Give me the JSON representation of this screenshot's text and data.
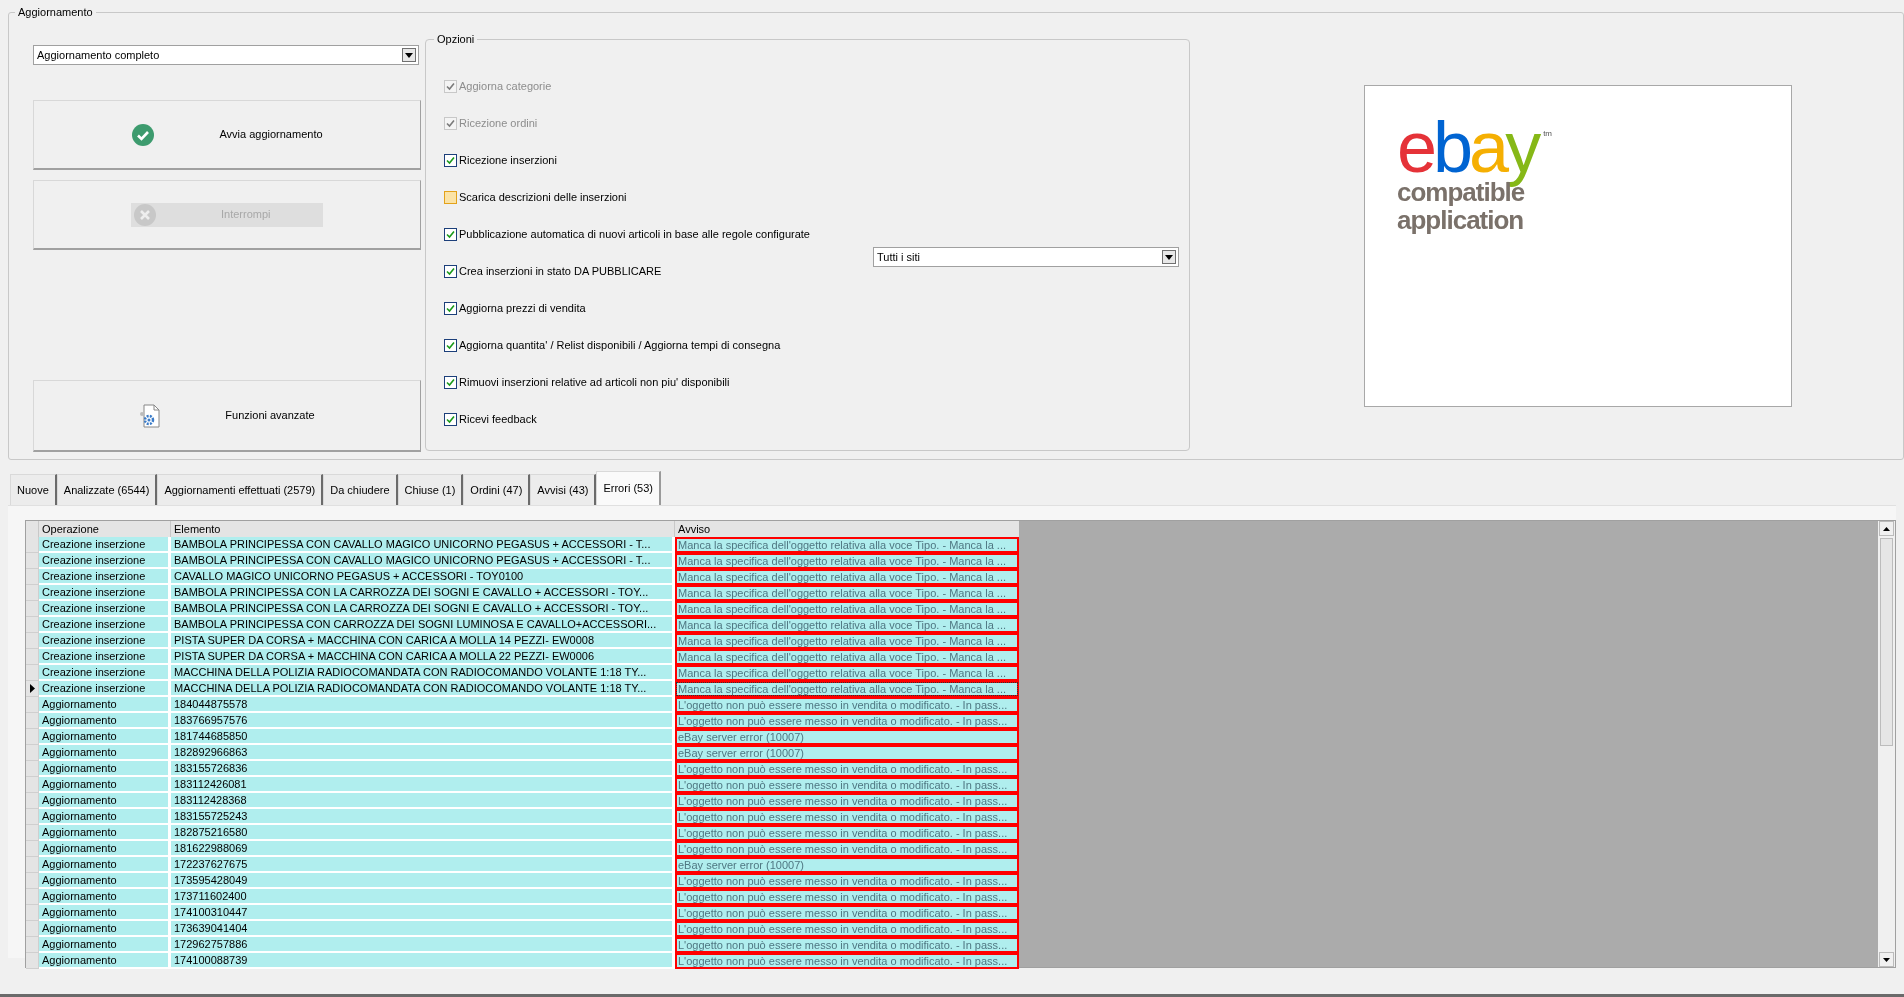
{
  "group_title": "Aggiornamento",
  "mode_dropdown": {
    "value": "Aggiornamento completo"
  },
  "buttons": [
    {
      "kind": "start",
      "label": "Avvia aggiornamento",
      "disabled": false
    },
    {
      "kind": "stop",
      "label": "Interrompi",
      "disabled": true
    },
    {
      "kind": "advanced",
      "label": "Funzioni avanzate",
      "disabled": false
    }
  ],
  "options": {
    "title": "Opzioni",
    "items": [
      {
        "label": "Aggiorna categorie",
        "checked": true,
        "disabled": true
      },
      {
        "label": "Ricezione ordini",
        "checked": true,
        "disabled": true
      },
      {
        "label": "Ricezione inserzioni",
        "checked": true,
        "disabled": false
      },
      {
        "label": "Scarica descrizioni delle inserzioni",
        "checked": false,
        "disabled": false
      },
      {
        "label": "Pubblicazione automatica di nuovi articoli in base alle regole configurate",
        "checked": true,
        "disabled": false
      },
      {
        "label": "Crea inserzioni in stato DA PUBBLICARE",
        "checked": true,
        "disabled": false
      },
      {
        "label": "Aggiorna prezzi di vendita",
        "checked": true,
        "disabled": false
      },
      {
        "label": "Aggiorna quantita' / Relist disponibili / Aggiorna tempi di consegna",
        "checked": true,
        "disabled": false
      },
      {
        "label": "Rimuovi inserzioni relative ad articoli non piu' disponibili",
        "checked": true,
        "disabled": false
      },
      {
        "label": "Ricevi feedback",
        "checked": true,
        "disabled": false
      }
    ],
    "site_dropdown": {
      "value": "Tutti i siti"
    }
  },
  "logo": {
    "letters": [
      {
        "text": "e",
        "color": "#e53238"
      },
      {
        "text": "b",
        "color": "#0064d2"
      },
      {
        "text": "a",
        "color": "#f5af02"
      },
      {
        "text": "y",
        "color": "#86b817"
      }
    ],
    "tm": "tm",
    "lines": [
      "compatible",
      "application"
    ]
  },
  "tabs": [
    {
      "label": "Nuove",
      "selected": false
    },
    {
      "label": "Analizzate (6544)",
      "selected": false
    },
    {
      "label": "Aggiornamenti effettuati (2579)",
      "selected": false
    },
    {
      "label": "Da chiudere",
      "selected": false
    },
    {
      "label": "Chiuse (1)",
      "selected": false
    },
    {
      "label": "Ordini (47)",
      "selected": false
    },
    {
      "label": "Avvisi (43)",
      "selected": false
    },
    {
      "label": "Errori (53)",
      "selected": true
    }
  ],
  "table": {
    "columns": [
      "Operazione",
      "Elemento",
      "Avviso"
    ],
    "rows": [
      {
        "operazione": "Creazione inserzione",
        "elemento": "BAMBOLA PRINCIPESSA CON CAVALLO MAGICO UNICORNO PEGASUS + ACCESSORI - T...",
        "avviso": "Manca la specifica dell'oggetto relativa alla voce Tipo. - Manca la ...",
        "selected": false
      },
      {
        "operazione": "Creazione inserzione",
        "elemento": "BAMBOLA PRINCIPESSA CON CAVALLO MAGICO UNICORNO PEGASUS + ACCESSORI - T...",
        "avviso": "Manca la specifica dell'oggetto relativa alla voce Tipo. - Manca la ...",
        "selected": false
      },
      {
        "operazione": "Creazione inserzione",
        "elemento": "CAVALLO MAGICO UNICORNO PEGASUS + ACCESSORI - TOY0100",
        "avviso": "Manca la specifica dell'oggetto relativa alla voce Tipo. - Manca la ...",
        "selected": false
      },
      {
        "operazione": "Creazione inserzione",
        "elemento": "BAMBOLA PRINCIPESSA CON LA CARROZZA DEI SOGNI E CAVALLO + ACCESSORI - TOY...",
        "avviso": "Manca la specifica dell'oggetto relativa alla voce Tipo. - Manca la ...",
        "selected": false
      },
      {
        "operazione": "Creazione inserzione",
        "elemento": "BAMBOLA PRINCIPESSA CON LA CARROZZA DEI SOGNI E CAVALLO + ACCESSORI - TOY...",
        "avviso": "Manca la specifica dell'oggetto relativa alla voce Tipo. - Manca la ...",
        "selected": false
      },
      {
        "operazione": "Creazione inserzione",
        "elemento": "BAMBOLA PRINCIPESSA CON CARROZZA DEI SOGNI LUMINOSA E CAVALLO+ACCESSORI...",
        "avviso": "Manca la specifica dell'oggetto relativa alla voce Tipo. - Manca la ...",
        "selected": false
      },
      {
        "operazione": "Creazione inserzione",
        "elemento": "PISTA SUPER DA CORSA + MACCHINA CON CARICA A MOLLA 14 PEZZI- EW0008",
        "avviso": "Manca la specifica dell'oggetto relativa alla voce Tipo. - Manca la ...",
        "selected": false
      },
      {
        "operazione": "Creazione inserzione",
        "elemento": "PISTA SUPER DA CORSA + MACCHINA CON CARICA A MOLLA 22 PEZZI- EW0006",
        "avviso": "Manca la specifica dell'oggetto relativa alla voce Tipo. - Manca la ...",
        "selected": false
      },
      {
        "operazione": "Creazione inserzione",
        "elemento": "MACCHINA DELLA POLIZIA RADIOCOMANDATA CON RADIOCOMANDO VOLANTE 1:18 TY...",
        "avviso": "Manca la specifica dell'oggetto relativa alla voce Tipo. - Manca la ...",
        "selected": false
      },
      {
        "operazione": "Creazione inserzione",
        "elemento": "MACCHINA DELLA POLIZIA RADIOCOMANDATA CON RADIOCOMANDO VOLANTE 1:18 TY...",
        "avviso": "Manca la specifica dell'oggetto relativa alla voce Tipo. - Manca la ...",
        "selected": true
      },
      {
        "operazione": "Aggiornamento",
        "elemento": "184044875578",
        "avviso": "L'oggetto non può essere messo in vendita o modificato. - In pass...",
        "selected": false
      },
      {
        "operazione": "Aggiornamento",
        "elemento": "183766957576",
        "avviso": "L'oggetto non può essere messo in vendita o modificato. - In pass...",
        "selected": false
      },
      {
        "operazione": "Aggiornamento",
        "elemento": "181744685850",
        "avviso": "eBay server error (10007)",
        "selected": false
      },
      {
        "operazione": "Aggiornamento",
        "elemento": "182892966863",
        "avviso": "eBay server error (10007)",
        "selected": false
      },
      {
        "operazione": "Aggiornamento",
        "elemento": "183155726836",
        "avviso": "L'oggetto non può essere messo in vendita o modificato. - In pass...",
        "selected": false
      },
      {
        "operazione": "Aggiornamento",
        "elemento": "183112426081",
        "avviso": "L'oggetto non può essere messo in vendita o modificato. - In pass...",
        "selected": false
      },
      {
        "operazione": "Aggiornamento",
        "elemento": "183112428368",
        "avviso": "L'oggetto non può essere messo in vendita o modificato. - In pass...",
        "selected": false
      },
      {
        "operazione": "Aggiornamento",
        "elemento": "183155725243",
        "avviso": "L'oggetto non può essere messo in vendita o modificato. - In pass...",
        "selected": false
      },
      {
        "operazione": "Aggiornamento",
        "elemento": "182875216580",
        "avviso": "L'oggetto non può essere messo in vendita o modificato. - In pass...",
        "selected": false
      },
      {
        "operazione": "Aggiornamento",
        "elemento": "181622988069",
        "avviso": "L'oggetto non può essere messo in vendita o modificato. - In pass...",
        "selected": false
      },
      {
        "operazione": "Aggiornamento",
        "elemento": "172237627675",
        "avviso": "eBay server error (10007)",
        "selected": false
      },
      {
        "operazione": "Aggiornamento",
        "elemento": "173595428049",
        "avviso": "L'oggetto non può essere messo in vendita o modificato. - In pass...",
        "selected": false
      },
      {
        "operazione": "Aggiornamento",
        "elemento": "173711602400",
        "avviso": "L'oggetto non può essere messo in vendita o modificato. - In pass...",
        "selected": false
      },
      {
        "operazione": "Aggiornamento",
        "elemento": "174100310447",
        "avviso": "L'oggetto non può essere messo in vendita o modificato. - In pass...",
        "selected": false
      },
      {
        "operazione": "Aggiornamento",
        "elemento": "173639041404",
        "avviso": "L'oggetto non può essere messo in vendita o modificato. - In pass...",
        "selected": false
      },
      {
        "operazione": "Aggiornamento",
        "elemento": "172962757886",
        "avviso": "L'oggetto non può essere messo in vendita o modificato. - In pass...",
        "selected": false
      },
      {
        "operazione": "Aggiornamento",
        "elemento": "174100088739",
        "avviso": "L'oggetto non può essere messo in vendita o modificato. - In pass...",
        "selected": false
      }
    ]
  }
}
